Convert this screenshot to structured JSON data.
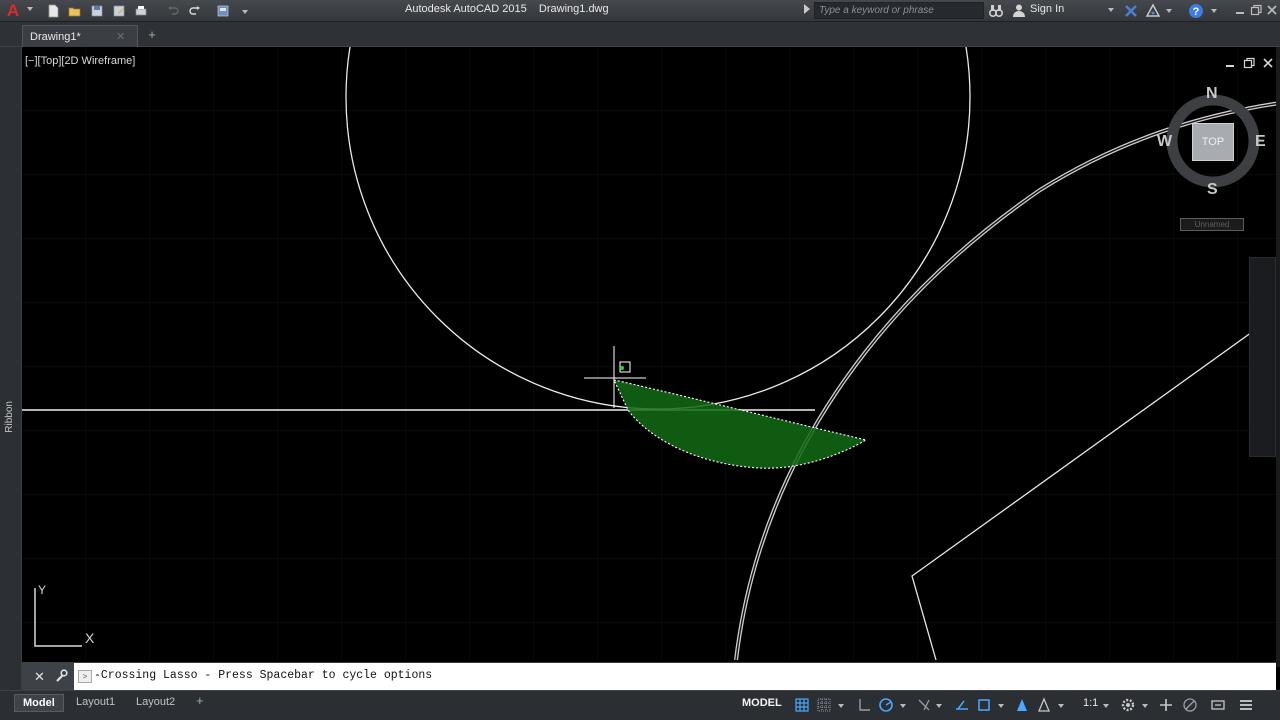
{
  "app": {
    "title": "Autodesk AutoCAD 2015    Drawing1.dwg",
    "logo_letter": "A"
  },
  "search": {
    "placeholder": "Type a keyword or phrase"
  },
  "account": {
    "sign_in_label": "Sign In"
  },
  "file_tabs": {
    "active_label": "Drawing1*",
    "new_tab_symbol": "+"
  },
  "ribbon": {
    "label": "Ribbon"
  },
  "viewport": {
    "label": "[−][Top][2D Wireframe]",
    "viewcube": {
      "north": "N",
      "south": "S",
      "east": "E",
      "west": "W",
      "face": "TOP",
      "ucs_menu": "Unnamed"
    },
    "ucs": {
      "x_label": "X",
      "y_label": "Y"
    },
    "selection": {
      "fill_color": "#116b14",
      "outline_color": "#ffffff"
    }
  },
  "command_line": {
    "close_symbol": "✕",
    "text": "-Crossing Lasso - Press Spacebar to cycle options"
  },
  "status_bar": {
    "layouts": [
      "Model",
      "Layout1",
      "Layout2"
    ],
    "add_layout_symbol": "+",
    "space_label": "MODEL",
    "scale_label": "1:1",
    "accent_color": "#4aa8ff"
  }
}
